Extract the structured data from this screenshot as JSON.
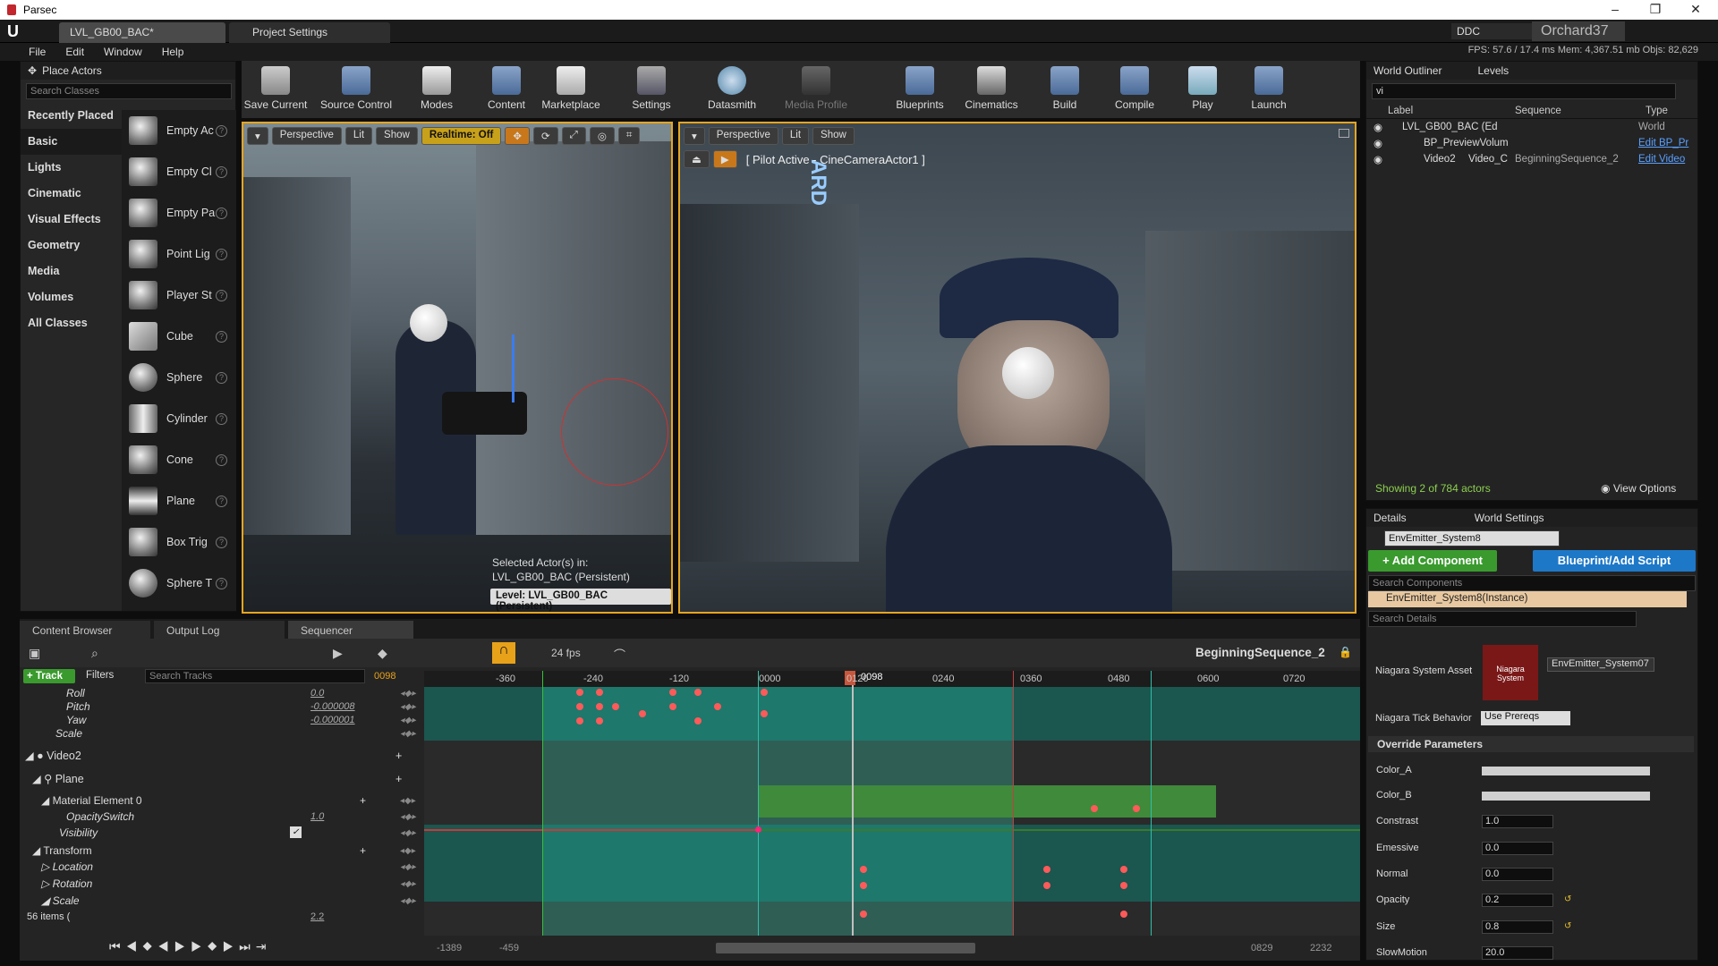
{
  "window": {
    "title": "Parsec"
  },
  "editor": {
    "tabs": [
      "LVL_GB00_BAC*",
      "Project Settings"
    ],
    "ddc_label": "DDC",
    "project": "Orchard37",
    "menu": [
      "File",
      "Edit",
      "Window",
      "Help"
    ],
    "stats": "FPS: 57.6  /  17.4 ms  Mem: 4,367.51 mb  Objs: 82,629"
  },
  "place_actors": {
    "title": "Place Actors",
    "search_placeholder": "Search Classes",
    "categories": [
      "Recently Placed",
      "Basic",
      "Lights",
      "Cinematic",
      "Visual Effects",
      "Geometry",
      "Media",
      "Volumes",
      "All Classes"
    ],
    "selected_category": "Basic",
    "items": [
      "Empty Ac",
      "Empty Cl",
      "Empty Pa",
      "Point Lig",
      "Player St",
      "Cube",
      "Sphere",
      "Cylinder",
      "Cone",
      "Plane",
      "Box Trig",
      "Sphere T"
    ]
  },
  "toolbar": {
    "buttons": [
      "Save Current",
      "Source Control",
      "Modes",
      "Content",
      "Marketplace",
      "Settings",
      "Datasmith",
      "Media Profile",
      "Blueprints",
      "Cinematics",
      "Build",
      "Compile",
      "Play",
      "Launch"
    ]
  },
  "viewport_left": {
    "perspective": "Perspective",
    "lit": "Lit",
    "show": "Show",
    "realtime": "Realtime: Off",
    "selected_text": "Selected Actor(s) in:",
    "selected_level": "LVL_GB00_BAC (Persistent)",
    "level_badge": "Level:  LVL_GB00_BAC (Persistent)"
  },
  "viewport_right": {
    "perspective": "Perspective",
    "lit": "Lit",
    "show": "Show",
    "pilot": "[ Pilot Active - CineCameraActor1 ]"
  },
  "outliner": {
    "tabs": [
      "World Outliner",
      "Levels"
    ],
    "search_value": "vi",
    "columns": [
      "Label",
      "Sequence",
      "Type"
    ],
    "rows": [
      {
        "label": "LVL_GB00_BAC (Ed",
        "sequence": "",
        "type": "World"
      },
      {
        "label": "BP_PreviewVolum",
        "sequence": "",
        "type": "Edit BP_Pr"
      },
      {
        "label": "Video2",
        "extra": "Video_C",
        "sequence": "BeginningSequence_2",
        "type": "Edit Video"
      }
    ],
    "status": "Showing 2 of 784 actors",
    "view_options": "View Options"
  },
  "details": {
    "tabs": [
      "Details",
      "World Settings"
    ],
    "actor_name": "EnvEmitter_System8",
    "add_component": "+ Add Component",
    "blueprint": "Blueprint/Add Script",
    "search_components": "Search Components",
    "instance": "EnvEmitter_System8(Instance)",
    "search_details": "Search Details",
    "niagara_label": "Niagara System Asset",
    "niagara_thumb": "Niagara System",
    "niagara_value": "EnvEmitter_System07",
    "tick_label": "Niagara Tick Behavior",
    "tick_value": "Use Prereqs",
    "override_header": "Override Parameters",
    "params": [
      {
        "name": "Color_A",
        "value": ""
      },
      {
        "name": "Color_B",
        "value": ""
      },
      {
        "name": "Constrast",
        "value": "1.0"
      },
      {
        "name": "Emessive",
        "value": "0.0"
      },
      {
        "name": "Normal",
        "value": "0.0"
      },
      {
        "name": "Opacity",
        "value": "0.2"
      },
      {
        "name": "Size",
        "value": "0.8"
      },
      {
        "name": "SlowMotion",
        "value": "20.0"
      }
    ]
  },
  "bottom_tabs": [
    "Content Browser",
    "Output Log",
    "Sequencer"
  ],
  "sequencer": {
    "fps": "24 fps",
    "sequence_name": "BeginningSequence_2",
    "track_button": "+ Track",
    "filters": "Filters",
    "search_placeholder": "Search Tracks",
    "current_frame": "0098",
    "playhead_label": "0098",
    "ruler_ticks": [
      "-360",
      "-240",
      "-120",
      "0000",
      "0120",
      "0240",
      "0360",
      "0480",
      "0600",
      "0720"
    ],
    "range_start": "-1389",
    "range_start2": "-459",
    "range_end": "0829",
    "range_end2": "2232",
    "items_count": "56 items (",
    "tracks": [
      {
        "name": "Roll",
        "value": "0.0"
      },
      {
        "name": "Pitch",
        "value": "-0.000008"
      },
      {
        "name": "Yaw",
        "value": "-0.000001"
      },
      {
        "name": "Scale",
        "value": ""
      },
      {
        "name": "Video2",
        "value": ""
      },
      {
        "name": "Plane",
        "value": ""
      },
      {
        "name": "Material Element 0",
        "value": ""
      },
      {
        "name": "OpacitySwitch",
        "value": "1.0"
      },
      {
        "name": "Visibility",
        "value": ""
      },
      {
        "name": "Transform",
        "value": ""
      },
      {
        "name": "Location",
        "value": ""
      },
      {
        "name": "Rotation",
        "value": ""
      },
      {
        "name": "Scale",
        "value": "2.2"
      }
    ]
  }
}
